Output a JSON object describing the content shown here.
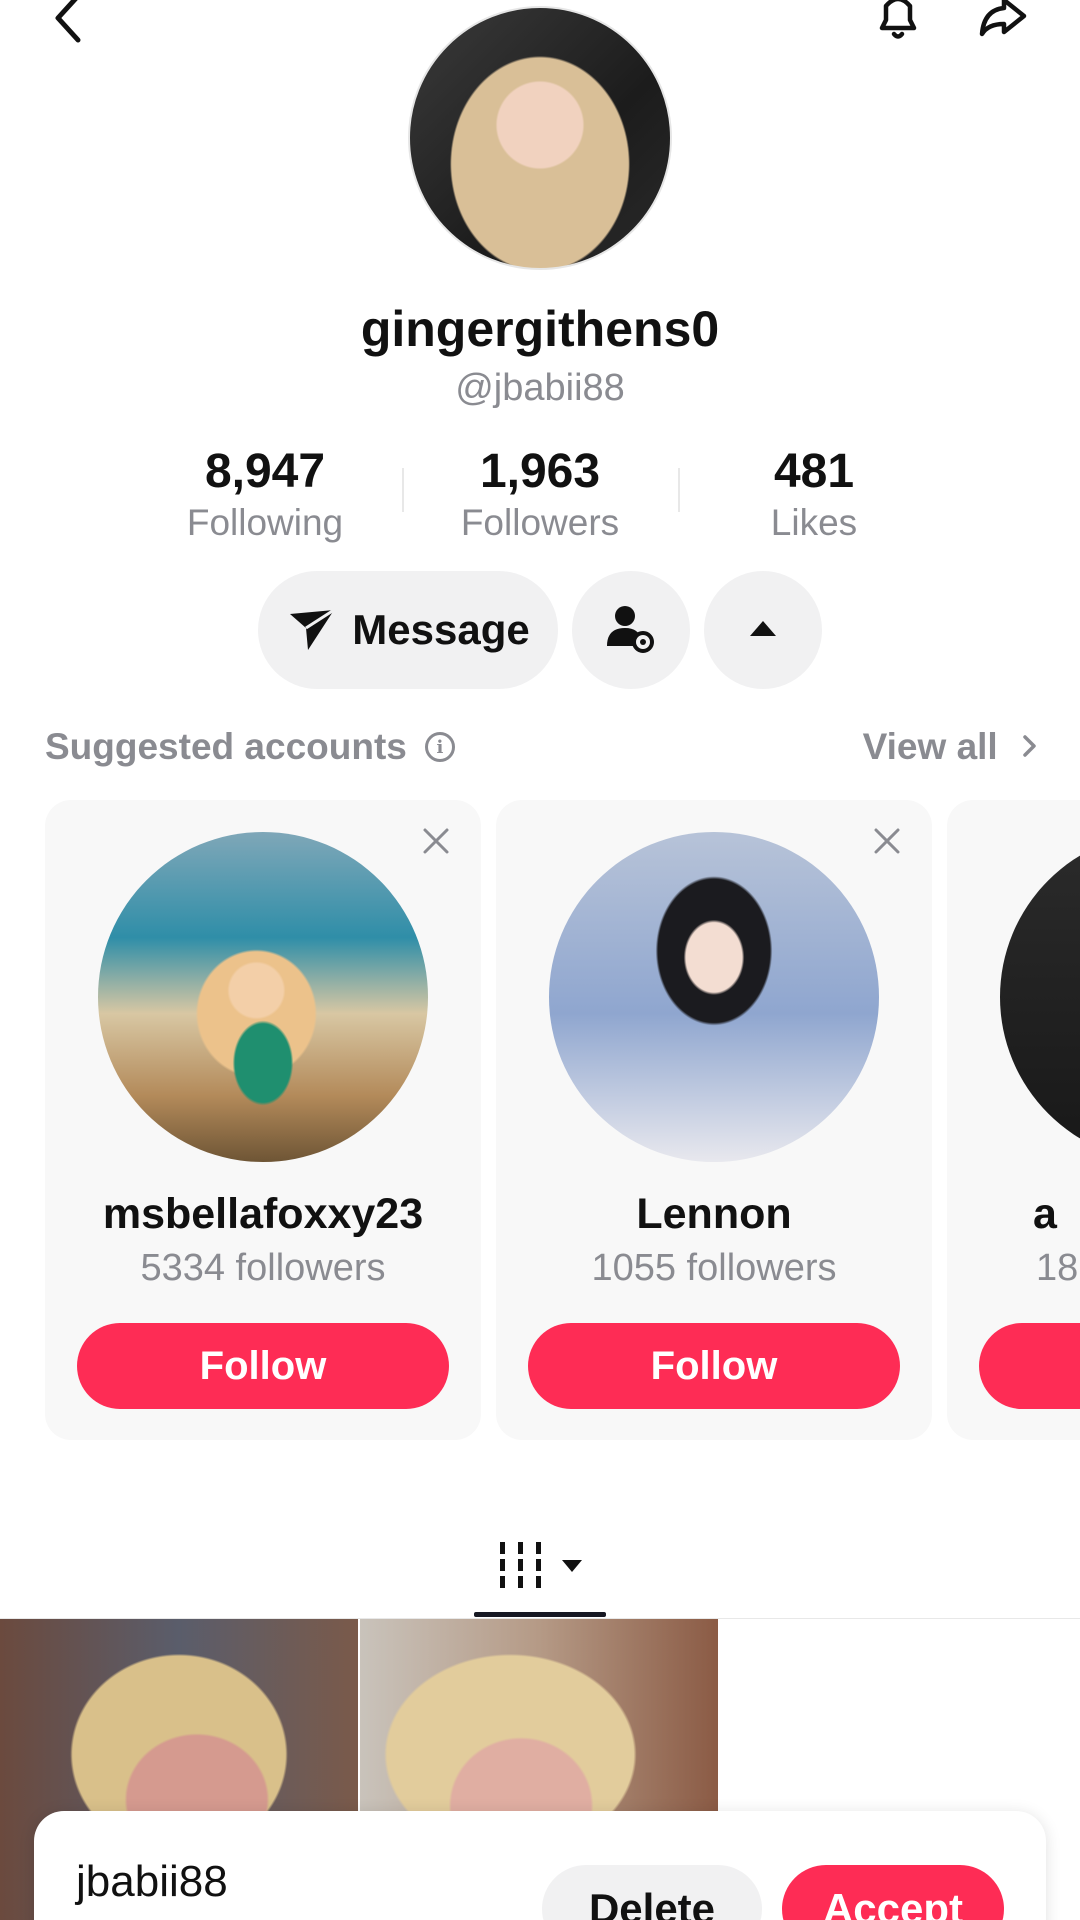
{
  "profile": {
    "display_name": "gingergithens0",
    "handle": "@jbabii88",
    "stats": [
      {
        "value": "8,947",
        "label": "Following"
      },
      {
        "value": "1,963",
        "label": "Followers"
      },
      {
        "value": "481",
        "label": "Likes"
      }
    ]
  },
  "actions": {
    "message_label": "Message"
  },
  "suggested": {
    "title": "Suggested accounts",
    "view_all": "View all",
    "cards": [
      {
        "name": "msbellafoxxy23",
        "followers": "5334 followers",
        "follow_label": "Follow"
      },
      {
        "name": "Lennon",
        "followers": "1055 followers",
        "follow_label": "Follow"
      },
      {
        "name": "a",
        "followers": "18",
        "follow_label": ""
      }
    ]
  },
  "request": {
    "name": "jbabii88",
    "subtitle": "",
    "delete_label": "Delete",
    "accept_label": "Accept"
  },
  "colors": {
    "accent": "#fe2c55",
    "muted_text": "#8a8b91",
    "pill_bg": "#f1f1f2",
    "card_bg": "#f8f8f8"
  },
  "icons": [
    "back-arrow-icon",
    "bell-icon",
    "share-icon",
    "message-send-icon",
    "friend-settings-icon",
    "caret-up-icon",
    "info-icon",
    "chevron-right-icon",
    "close-icon",
    "grid-icon",
    "caret-down-icon"
  ]
}
